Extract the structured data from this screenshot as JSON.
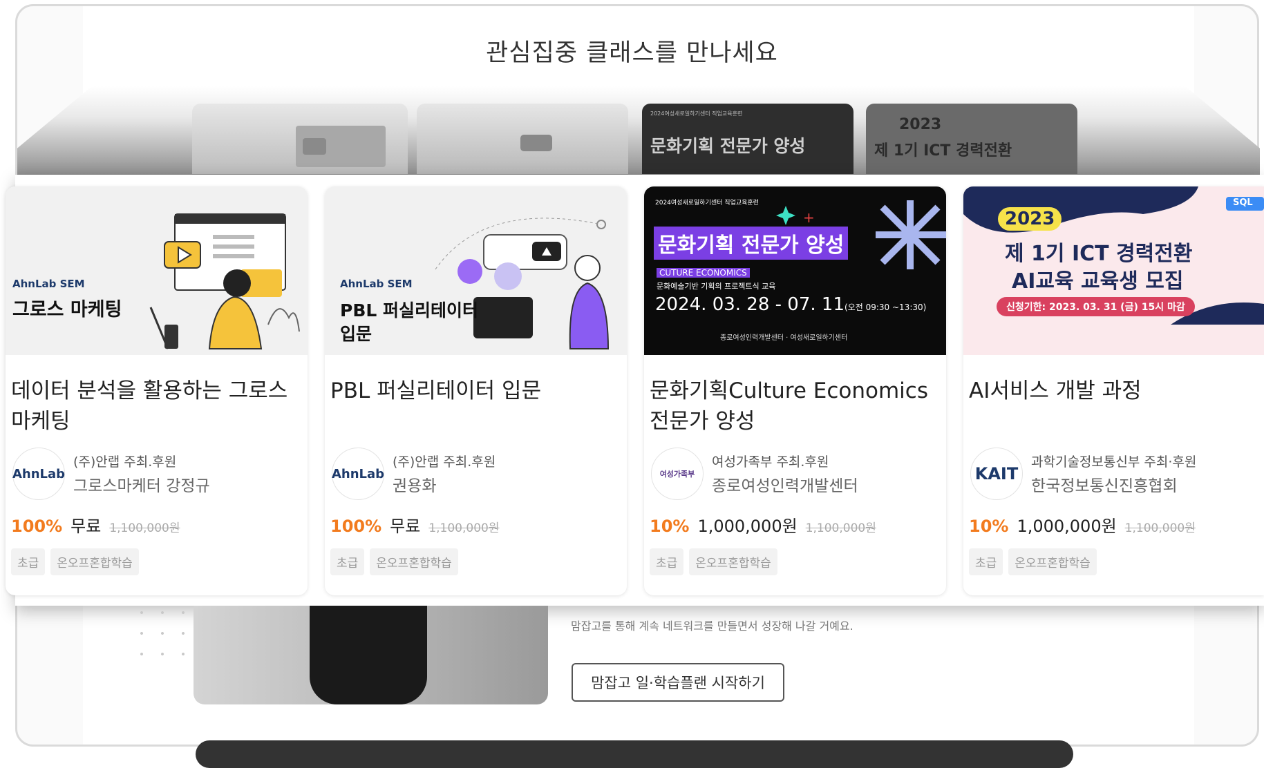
{
  "heading": "관심집중 클래스를 만나세요",
  "background_cards": [
    {
      "text": ""
    },
    {
      "text": ""
    },
    {
      "small": "2024여성새로일하기센터 직업교육훈련",
      "text": "문화기획 전문가 양성"
    },
    {
      "year": "2023",
      "text": "제 1기 ICT 경력전환"
    }
  ],
  "cards": [
    {
      "thumb": {
        "brand": "AhnLab SEM",
        "headline": "그로스 마케팅"
      },
      "title": "데이터 분석을 활용하는 그로스 마케팅",
      "logo": "AhnLab",
      "host": "(주)안랩 주최.후원",
      "instructor": "그로스마케터 강정규",
      "discount": "100%",
      "price": "무료",
      "original": "1,100,000원",
      "tags": [
        "초급",
        "온오프혼합학습"
      ]
    },
    {
      "thumb": {
        "brand": "AhnLab SEM",
        "headline": "PBL 퍼실리테이터",
        "headline2": "입문"
      },
      "title": "PBL 퍼실리테이터 입문",
      "logo": "AhnLab",
      "host": "(주)안랩 주최.후원",
      "instructor": "권용화",
      "discount": "100%",
      "price": "무료",
      "original": "1,100,000원",
      "tags": [
        "초급",
        "온오프혼합학습"
      ]
    },
    {
      "thumb": {
        "small": "2024여성새로일하기센터 직업교육훈련",
        "headline": "문화기획 전문가 양성",
        "sub1": "CUTURE ECONOMICS",
        "sub2": "문화예술기반 기획의 프로젝트식 교육",
        "dates": "2024. 03. 28 - 07. 11",
        "time": "(오전 09:30 ~13:30)",
        "org": "종로여성인력개발센터 · 여성새로일하기센터"
      },
      "title": "문화기획Culture Economics전문가 양성",
      "logo": "여성가족부",
      "host": "여성가족부 주최.후원",
      "instructor": "종로여성인력개발센터",
      "discount": "10%",
      "price": "1,000,000원",
      "original": "1,100,000원",
      "tags": [
        "초급",
        "온오프혼합학습"
      ]
    },
    {
      "thumb": {
        "year": "2023",
        "line1": "제 1기 ICT 경력전환",
        "line2": "AI교육 교육생 모집",
        "deadline": "신청기한: 2023. 03. 31 (금) 15시 마감",
        "badge": "SQL"
      },
      "title": "AI서비스 개발 과정",
      "logo": "KAIT",
      "host": "과학기술정보통신부 주최·후원",
      "instructor": "한국정보통신진흥협회",
      "discount": "10%",
      "price": "1,000,000원",
      "original": "1,100,000원",
      "tags": [
        "초급",
        "온오프혼합학습"
      ]
    }
  ],
  "lower": {
    "description": "맘잡고를 통해 계속 네트워크를 만들면서 성장해 나갈 거예요.",
    "button": "맘잡고 일·학습플랜 시작하기"
  },
  "colors": {
    "accent": "#f27b1e",
    "purple": "#7b3fe4",
    "navy": "#1e2a5a",
    "deadline_red": "#d9415f"
  }
}
